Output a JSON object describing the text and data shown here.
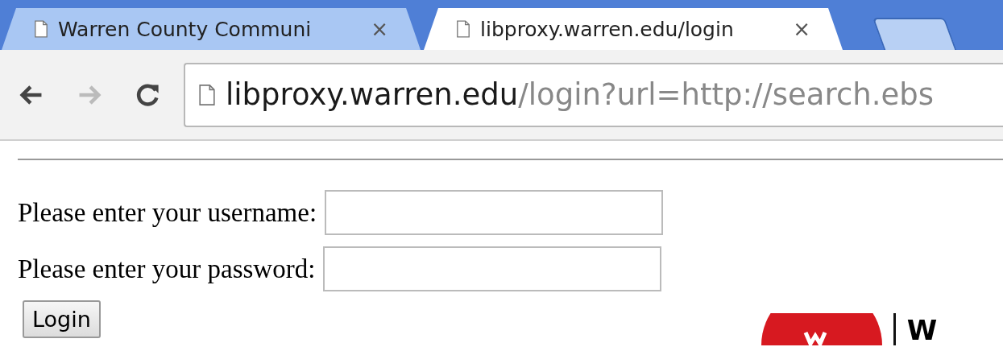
{
  "tabs": [
    {
      "title": "Warren County Communi",
      "selected": false,
      "close": "×"
    },
    {
      "title": "libproxy.warren.edu/login",
      "selected": true,
      "close": "×"
    }
  ],
  "address_bar": {
    "host": "libproxy.warren.edu",
    "path": "/login?url=http://search.ebs"
  },
  "form": {
    "fields": [
      {
        "label": "Please enter your username:"
      },
      {
        "label": "Please enter your password:"
      }
    ],
    "button": "Login"
  },
  "logo": {
    "text": "W"
  }
}
